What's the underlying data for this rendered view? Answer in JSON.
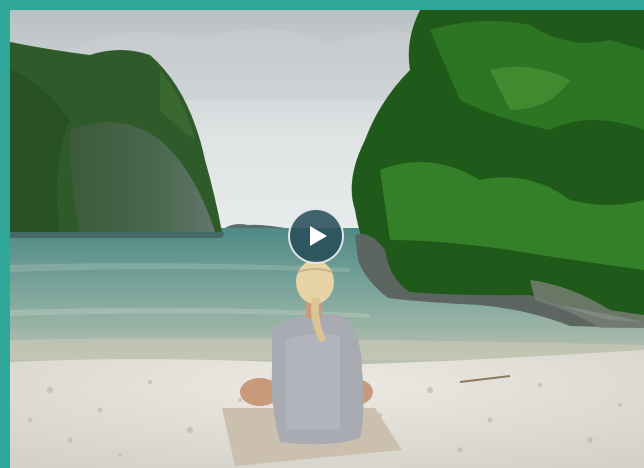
{
  "player": {
    "accent_color": "#2fa89a",
    "play_button_color": "#284e5a",
    "play_icon": "play-icon"
  }
}
